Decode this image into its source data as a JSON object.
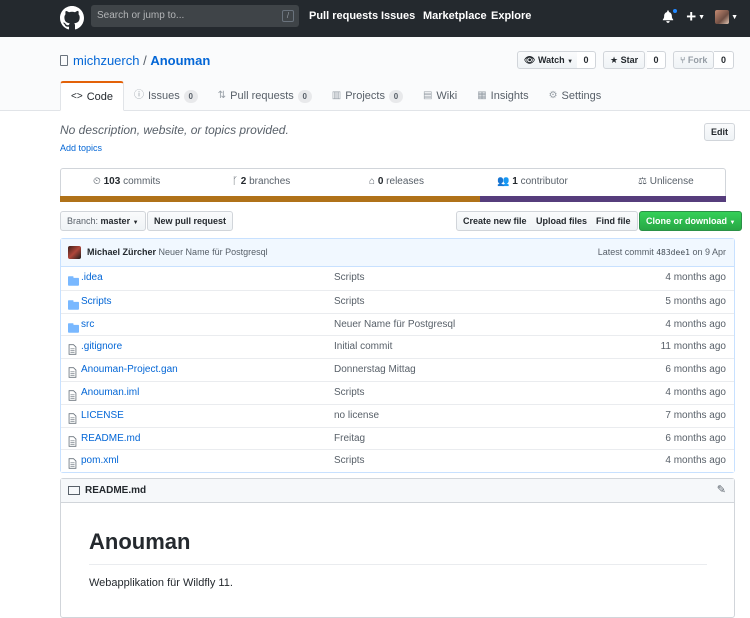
{
  "header": {
    "search_placeholder": "Search or jump to...",
    "search_shortcut": "/",
    "nav": [
      "Pull requests",
      "Issues",
      "Marketplace",
      "Explore"
    ]
  },
  "repo": {
    "owner": "michzuerch",
    "separator": "/",
    "name": "Anouman",
    "watch_label": "Watch",
    "watch_count": "0",
    "star_label": "Star",
    "star_count": "0",
    "fork_label": "Fork",
    "fork_count": "0"
  },
  "tabs": [
    {
      "label": "Code",
      "icon": "code-icon"
    },
    {
      "label": "Issues",
      "icon": "issue-icon",
      "count": "0"
    },
    {
      "label": "Pull requests",
      "icon": "pull-request-icon",
      "count": "0"
    },
    {
      "label": "Projects",
      "icon": "project-icon",
      "count": "0"
    },
    {
      "label": "Wiki",
      "icon": "wiki-icon"
    },
    {
      "label": "Insights",
      "icon": "graph-icon"
    },
    {
      "label": "Settings",
      "icon": "gear-icon"
    }
  ],
  "description": {
    "text": "No description, website, or topics provided.",
    "edit_label": "Edit",
    "add_topics": "Add topics"
  },
  "summary": {
    "commits_count": "103",
    "commits_label": "commits",
    "branches_count": "2",
    "branches_label": "branches",
    "releases_count": "0",
    "releases_label": "releases",
    "contributors_count": "1",
    "contributors_label": "contributor",
    "license": "Unlicense"
  },
  "language_bar": [
    {
      "color": "#b07219",
      "share": 0.63
    },
    {
      "color": "#563d7c",
      "share": 0.37
    }
  ],
  "file_nav": {
    "branch_prefix": "Branch:",
    "branch": "master",
    "new_pr": "New pull request",
    "create_file": "Create new file",
    "upload_files": "Upload files",
    "find_file": "Find file",
    "clone": "Clone or download"
  },
  "latest_commit": {
    "author": "Michael Zürcher",
    "message": "Neuer Name für Postgresql",
    "prefix": "Latest commit",
    "sha": "483dee1",
    "date": "on 9 Apr"
  },
  "files": [
    {
      "name": ".idea",
      "type": "folder",
      "message": "Scripts",
      "age": "4 months ago"
    },
    {
      "name": "Scripts",
      "type": "folder",
      "message": "Scripts",
      "age": "5 months ago"
    },
    {
      "name": "src",
      "type": "folder",
      "message": "Neuer Name für Postgresql",
      "age": "4 months ago"
    },
    {
      "name": ".gitignore",
      "type": "file",
      "message": "Initial commit",
      "age": "11 months ago"
    },
    {
      "name": "Anouman-Project.gan",
      "type": "file",
      "message": "Donnerstag Mittag",
      "age": "6 months ago"
    },
    {
      "name": "Anouman.iml",
      "type": "file",
      "message": "Scripts",
      "age": "4 months ago"
    },
    {
      "name": "LICENSE",
      "type": "file",
      "message": "no license",
      "age": "7 months ago"
    },
    {
      "name": "README.md",
      "type": "file",
      "message": "Freitag",
      "age": "6 months ago"
    },
    {
      "name": "pom.xml",
      "type": "file",
      "message": "Scripts",
      "age": "4 months ago"
    }
  ],
  "readme": {
    "filename": "README.md",
    "heading": "Anouman",
    "body": "Webapplikation für Wildfly 11."
  }
}
